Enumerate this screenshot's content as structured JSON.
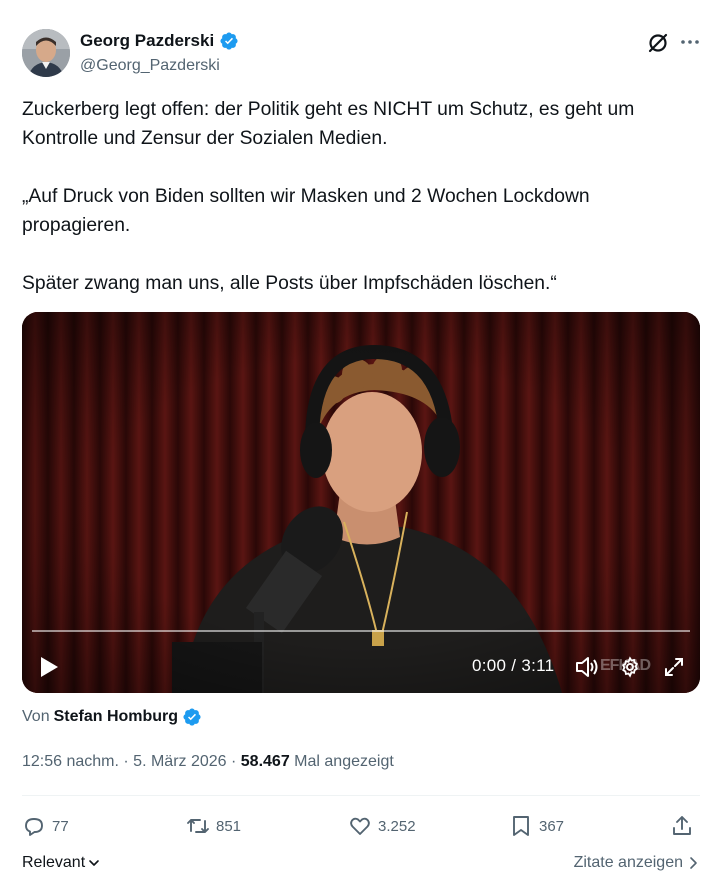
{
  "author": {
    "display_name": "Georg Pazderski",
    "handle": "@Georg_Pazderski",
    "verified_color": "#1d9bf0"
  },
  "tweet": {
    "paragraphs": [
      "Zuckerberg legt offen: der Politik geht es NICHT um Schutz, es geht um Kontrolle und Zensur der Sozialen Medien.",
      "„Auf Druck von Biden sollten wir Masken und 2 Wochen Lockdown propagieren.",
      "Später zwang man uns, alle Posts über Impfschäden löschen.“"
    ]
  },
  "video": {
    "time_readout": "0:00 / 3:11",
    "progress": 0,
    "watermark": "EFKAD",
    "icons": [
      "play-icon",
      "volume-icon",
      "settings-gear-icon",
      "fullscreen-icon"
    ]
  },
  "attribution": {
    "prefix": "Von",
    "source_author": "Stefan Homburg"
  },
  "meta": {
    "time": "12:56 nachm.",
    "separator": " · ",
    "date": "5. März 2026",
    "views": "58.467",
    "views_label": "Mal angezeigt"
  },
  "actions": {
    "replies": "77",
    "reposts": "851",
    "likes": "3.252",
    "bookmarks": "367",
    "icons": [
      "reply-icon",
      "repost-icon",
      "like-icon",
      "bookmark-icon",
      "share-icon"
    ]
  },
  "footer": {
    "sort_label": "Relevant",
    "quotes_label": "Zitate anzeigen"
  },
  "colors": {
    "text": "#0f1419",
    "secondary": "#536471",
    "accent": "#1d9bf0"
  }
}
